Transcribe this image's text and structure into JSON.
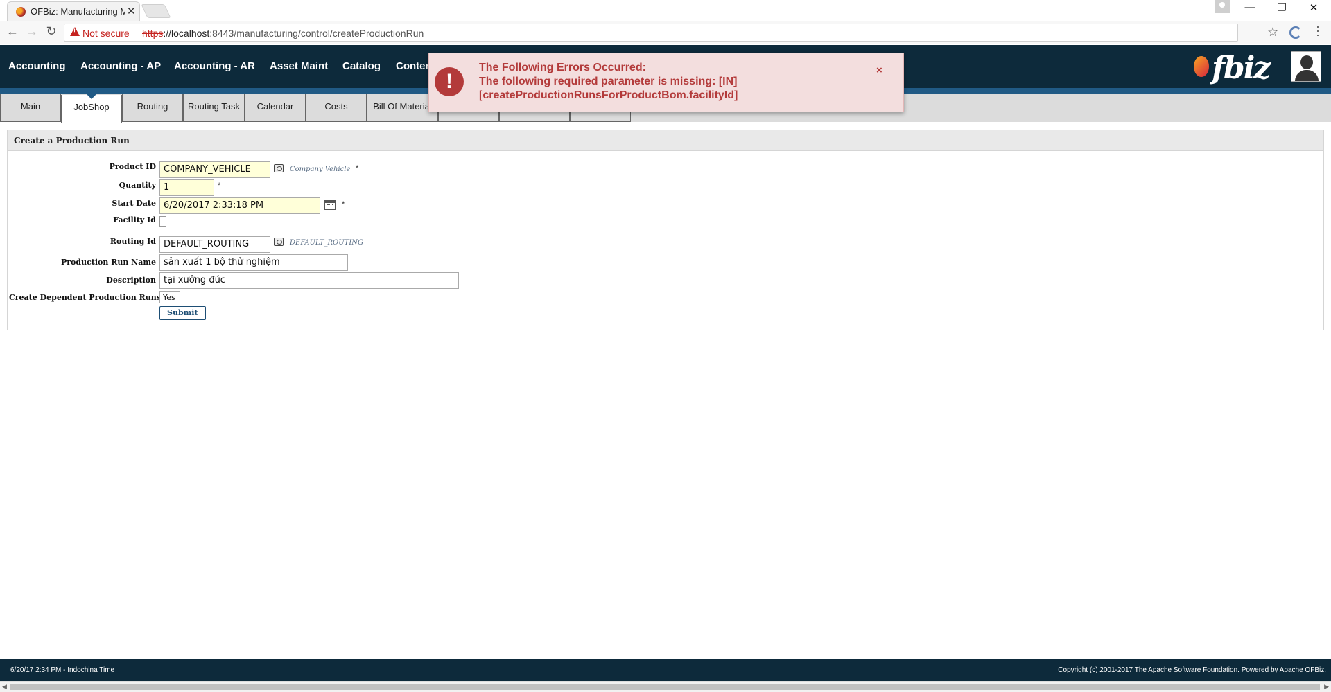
{
  "browser": {
    "tab_title": "OFBiz: Manufacturing M",
    "tab_close": "✕",
    "security_label": "Not secure",
    "url_scheme": "https",
    "url_host": "://localhost",
    "url_rest": ":8443/manufacturing/control/createProductionRun",
    "minimize": "—",
    "restore": "❐",
    "close": "✕"
  },
  "app_nav": [
    "Accounting",
    "Accounting - AP",
    "Accounting - AR",
    "Asset Maint",
    "Catalog",
    "Conter"
  ],
  "logo_text": "fbiz",
  "sub_tabs": [
    "Main",
    "JobShop",
    "Routing",
    "Routing Task",
    "Calendar",
    "Costs",
    "Bill Of Material",
    "",
    "",
    ""
  ],
  "error": {
    "title": "The Following Errors Occurred:",
    "line1": "The following required parameter is missing: [IN]",
    "line2": "[createProductionRunsForProductBom.facilityId]",
    "close": "×",
    "icon": "!"
  },
  "form": {
    "title": "Create a Production Run",
    "product_id_label": "Product ID",
    "product_id_value": "COMPANY_VEHICLE",
    "product_desc": "Company Vehicle",
    "quantity_label": "Quantity",
    "quantity_value": "1",
    "start_date_label": "Start Date",
    "start_date_value": "6/20/2017 2:33:18 PM",
    "facility_label": "Facility Id",
    "routing_label": "Routing Id",
    "routing_value": "DEFAULT_ROUTING",
    "routing_desc": "DEFAULT_ROUTING",
    "run_name_label": "Production Run Name",
    "run_name_value": "sản xuất 1 bộ thử nghiệm",
    "description_label": "Description",
    "description_value": "tại xưởng đúc",
    "dependent_label": "Create Dependent Production Runs",
    "dependent_value": "Yes",
    "submit_label": "Submit",
    "required_mark": "*"
  },
  "footer": {
    "left": "6/20/17 2:34 PM - Indochina Time",
    "right": "Copyright (c) 2001-2017 The Apache Software Foundation. Powered by Apache OFBiz."
  },
  "colors": {
    "header_bg": "#0d2a3b",
    "header_stripe": "#205a85",
    "error_bg": "#f3dede",
    "error_text": "#b33a3a",
    "required_input_bg": "#ffffd9"
  }
}
